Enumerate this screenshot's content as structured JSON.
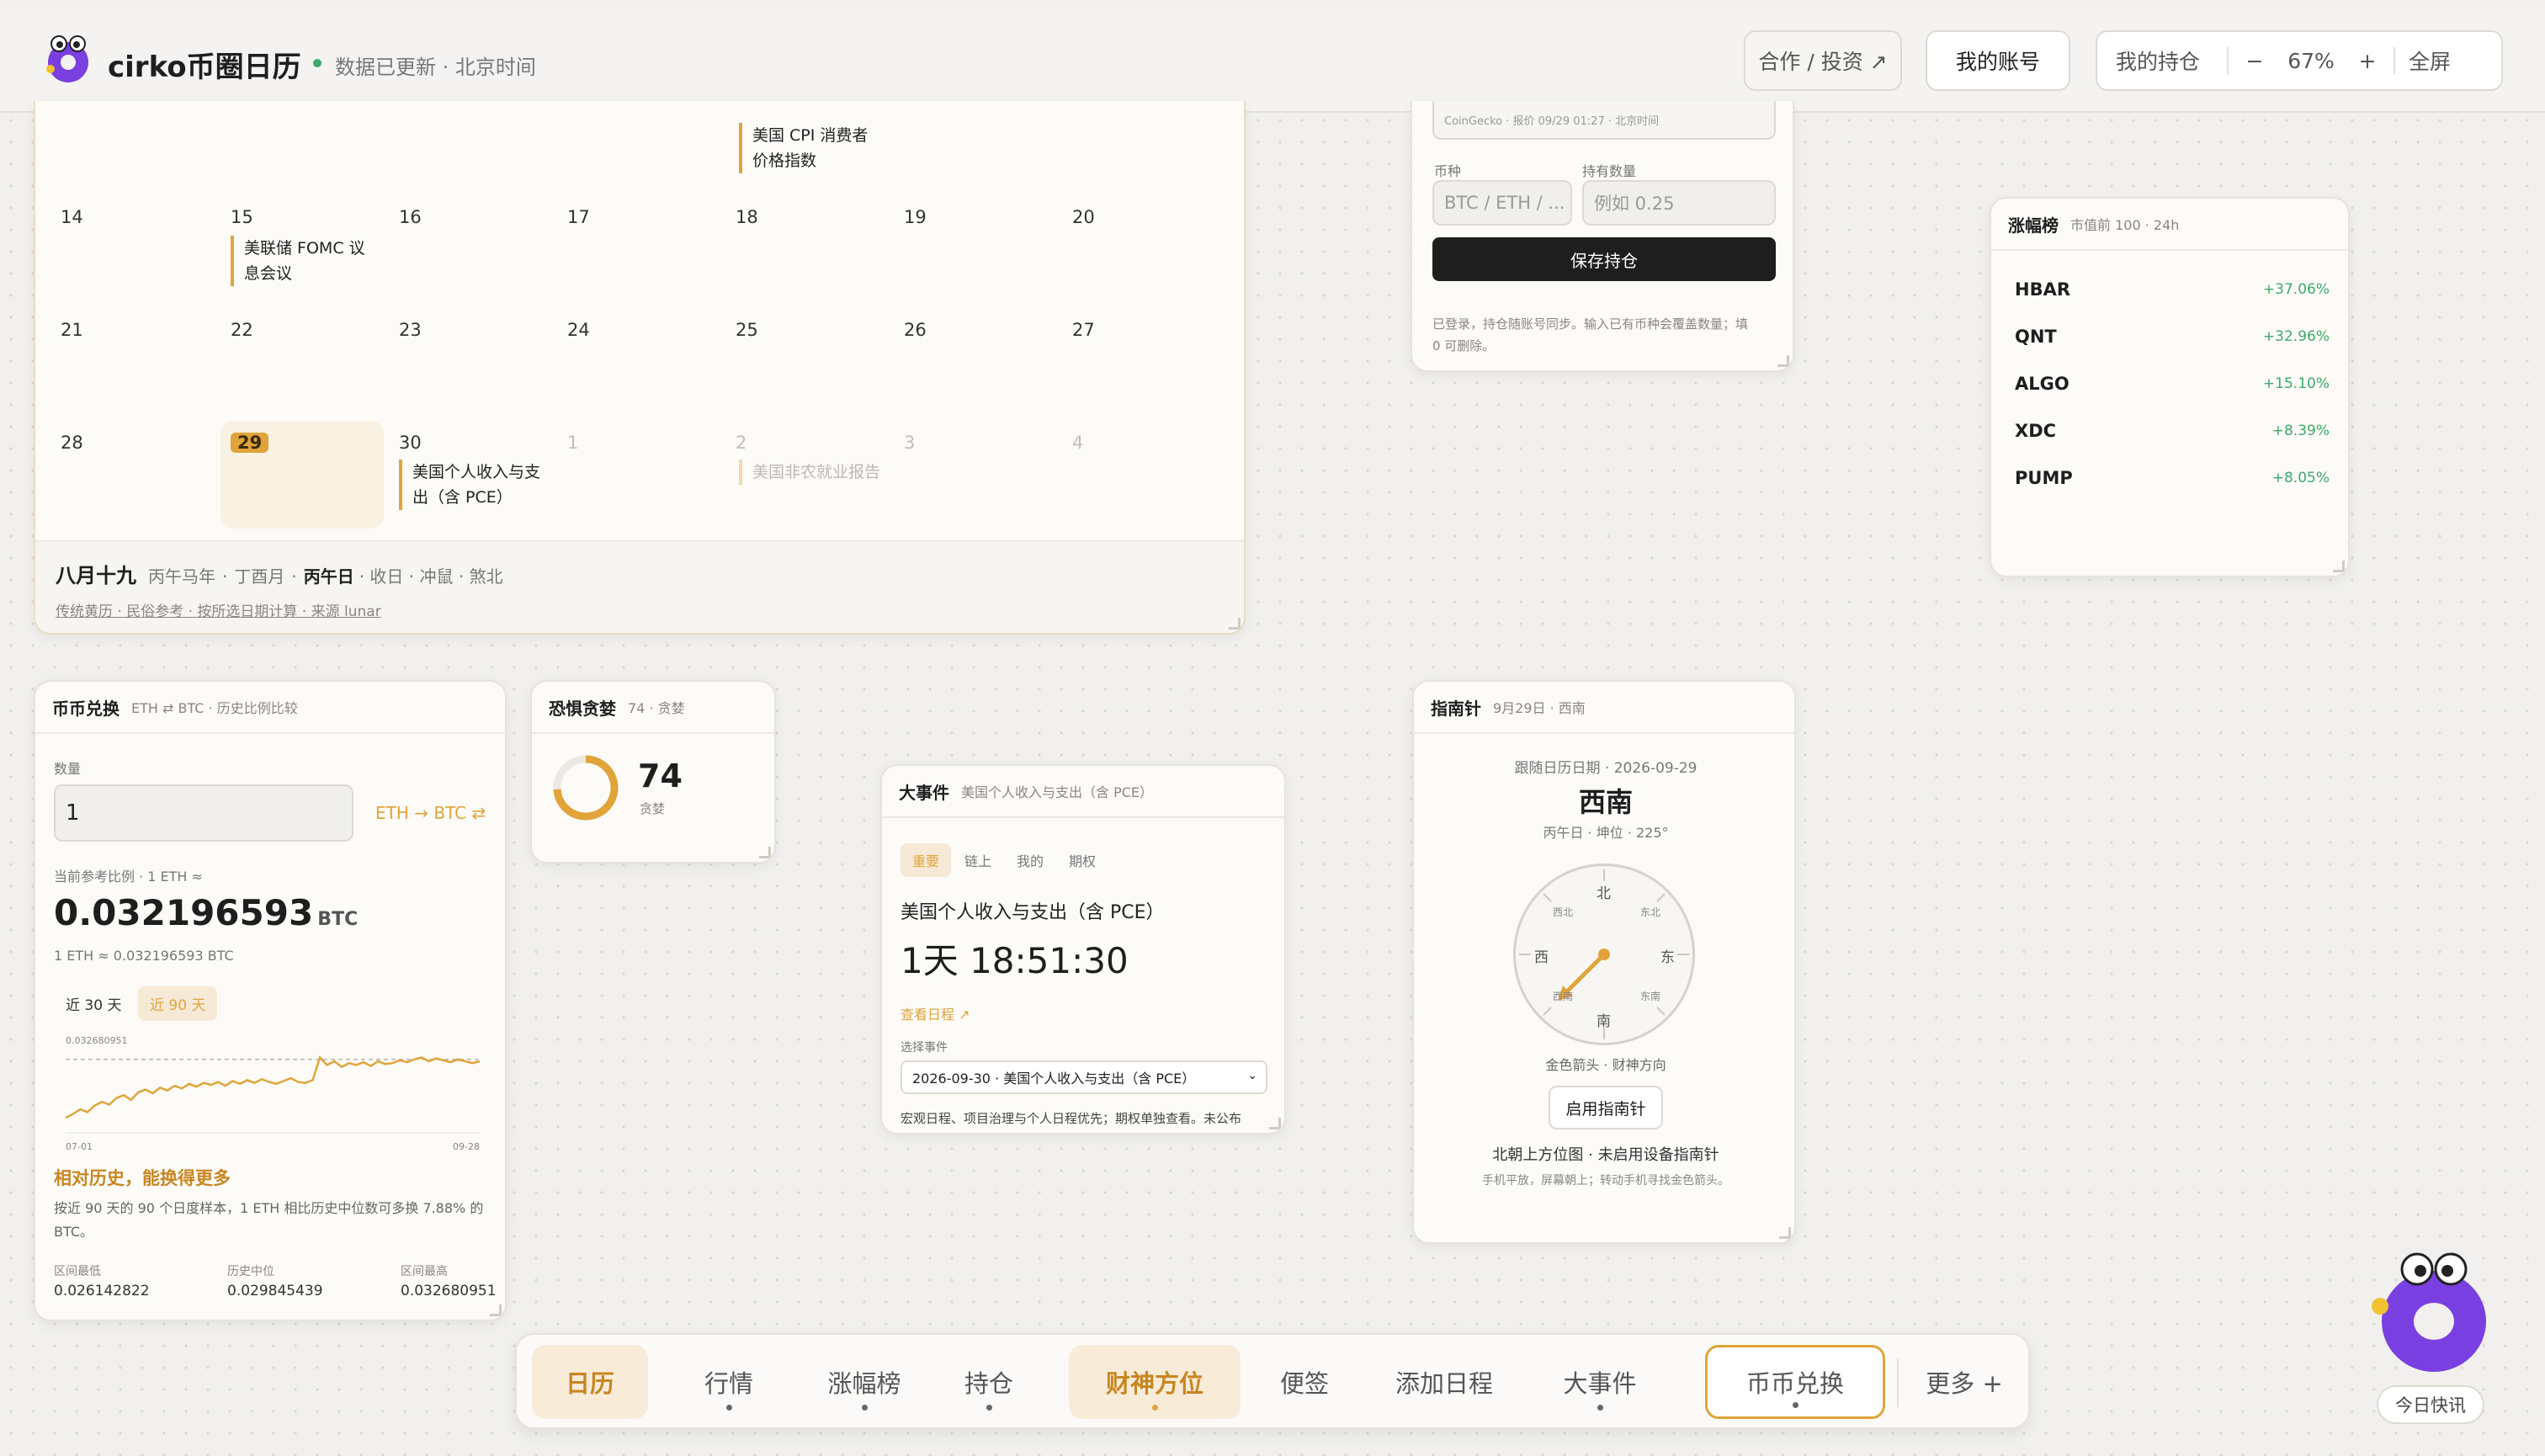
{
  "header": {
    "app_name": "cirko币圈日历",
    "status": "数据已更新 · 北京时间",
    "coop_label": "合作 / 投资 ↗",
    "account_label": "我的账号",
    "holdings_label": "我的持仓",
    "zoom_minus": "−",
    "zoom_value": "67%",
    "zoom_plus": "+",
    "fullscreen_label": "全屏"
  },
  "calendar": {
    "top_event": {
      "line1": "美国 CPI 消费者",
      "line2": "价格指数"
    },
    "weeks": [
      [
        "14",
        "15",
        "16",
        "17",
        "18",
        "19",
        "20"
      ],
      [
        "21",
        "22",
        "23",
        "24",
        "25",
        "26",
        "27"
      ],
      [
        "28",
        "29",
        "30",
        "1",
        "2",
        "3",
        "4"
      ]
    ],
    "events": {
      "fomc1": "美联储 FOMC 议",
      "fomc2": "息会议",
      "pce1": "美国个人收入与支",
      "pce2": "出（含 PCE）",
      "nfp": "美国非农就业报告"
    },
    "footer": {
      "lunar_day": "八月十九",
      "ganzhi_year": "丙午马年",
      "sep1": "·",
      "ganzhi_month": "丁酉月",
      "sep2": "·",
      "ganzhi_day": "丙午日",
      "rest": "· 收日 · 冲鼠 · 煞北",
      "note": "传统黄历 · 民俗参考 · 按所选日期计算 · 来源 lunar"
    }
  },
  "holdings": {
    "source": "CoinGecko · 报价 09/29 01:27 · 北京时间",
    "coin_label": "币种",
    "qty_label": "持有数量",
    "coin_placeholder": "BTC / ETH / ...",
    "qty_placeholder": "例如 0.25",
    "save_label": "保存持仓",
    "note1": "已登录，持仓随账号同步。输入已有币种会覆盖数量；填",
    "note2": "0 可删除。"
  },
  "gainers": {
    "title": "涨幅榜",
    "subtitle": "市值前 100 · 24h",
    "items": [
      {
        "symbol": "HBAR",
        "change": "+37.06%"
      },
      {
        "symbol": "QNT",
        "change": "+32.96%"
      },
      {
        "symbol": "ALGO",
        "change": "+15.10%"
      },
      {
        "symbol": "XDC",
        "change": "+8.39%"
      },
      {
        "symbol": "PUMP",
        "change": "+8.05%"
      }
    ]
  },
  "converter": {
    "title": "币币兑换",
    "subtitle": "ETH ⇄ BTC · 历史比例比较",
    "qty_label": "数量",
    "qty_value": "1",
    "pair": "ETH → BTC ⇄",
    "ratio_label": "当前参考比例 · 1 ETH ≈",
    "ratio_value": "0.032196593",
    "ratio_unit": "BTC",
    "ratio_note": "1 ETH ≈ 0.032196593 BTC",
    "tab30": "近 30 天",
    "tab90": "近 90 天",
    "chart_max": "0.032680951",
    "x_start": "07-01",
    "x_end": "09-28",
    "headline": "相对历史，能换得更多",
    "desc1": "按近 90 天的 90 个日度样本，1 ETH 相比历史中位数可多换 7.88% 的",
    "desc2": "BTC。",
    "stats": [
      {
        "label": "区间最低",
        "value": "0.026142822"
      },
      {
        "label": "历史中位",
        "value": "0.029845439"
      },
      {
        "label": "区间最高",
        "value": "0.032680951"
      }
    ]
  },
  "chart_data": {
    "type": "line",
    "title": "",
    "x": [
      "07-01",
      "09-28"
    ],
    "ylabel": "",
    "xlabel": "",
    "series": [
      {
        "values": [
          0.0262,
          0.0266,
          0.0271,
          0.0268,
          0.0275,
          0.0279,
          0.0276,
          0.0283,
          0.0286,
          0.0281,
          0.0289,
          0.0292,
          0.0288,
          0.0294,
          0.0291,
          0.0296,
          0.0293,
          0.0298,
          0.0295,
          0.0299,
          0.0297,
          0.03,
          0.0296,
          0.0301,
          0.0298,
          0.0302,
          0.0299,
          0.0303,
          0.03,
          0.0298,
          0.0301,
          0.0304,
          0.03,
          0.0299,
          0.0302,
          0.0326,
          0.0318,
          0.0322,
          0.0316,
          0.032,
          0.0318,
          0.0321,
          0.0317,
          0.0322,
          0.0319,
          0.032,
          0.0323,
          0.0321,
          0.0324,
          0.0326,
          0.0322,
          0.0325,
          0.0323,
          0.0321,
          0.0324,
          0.0322,
          0.032,
          0.0322
        ]
      }
    ],
    "reference_line": 0.0324,
    "ylim": [
      0.0255,
      0.033
    ]
  },
  "fear_greed": {
    "title": "恐惧贪婪",
    "subtitle": "74 · 贪婪",
    "value": "74",
    "label": "贪婪",
    "level": 0.74
  },
  "event": {
    "title": "大事件",
    "subtitle": "美国个人收入与支出（含 PCE）",
    "tabs": [
      "重要",
      "链上",
      "我的",
      "期权"
    ],
    "name": "美国个人收入与支出（含 PCE）",
    "countdown": "1天 18:51:30",
    "link": "查看日程 ↗",
    "select_label": "选择事件",
    "select_value": "2026-09-30 · 美国个人收入与支出（含 PCE）",
    "note": "宏观日程、项目治理与个人日程优先；期权单独查看。未公布"
  },
  "compass": {
    "title": "指南针",
    "subtitle": "9月29日 · 西南",
    "date_note": "跟随日历日期 · 2026-09-29",
    "direction": "西南",
    "detail": "丙午日 · 坤位 · 225°",
    "dirs": {
      "n": "北",
      "s": "南",
      "e": "东",
      "w": "西",
      "nw": "西北",
      "ne": "东北",
      "sw": "西南",
      "se": "东南"
    },
    "caption": "金色箭头 · 财神方向",
    "enable_label": "启用指南针",
    "status": "北朝上方位图 · 未启用设备指南针",
    "hint": "手机平放，屏幕朝上；转动手机寻找金色箭头。"
  },
  "nav": {
    "items": [
      "日历",
      "行情",
      "涨幅榜",
      "持仓",
      "财神方位",
      "便签",
      "添加日程",
      "大事件",
      "币币兑换"
    ],
    "more": "更多 +"
  },
  "mascot": {
    "label": "今日快讯"
  }
}
